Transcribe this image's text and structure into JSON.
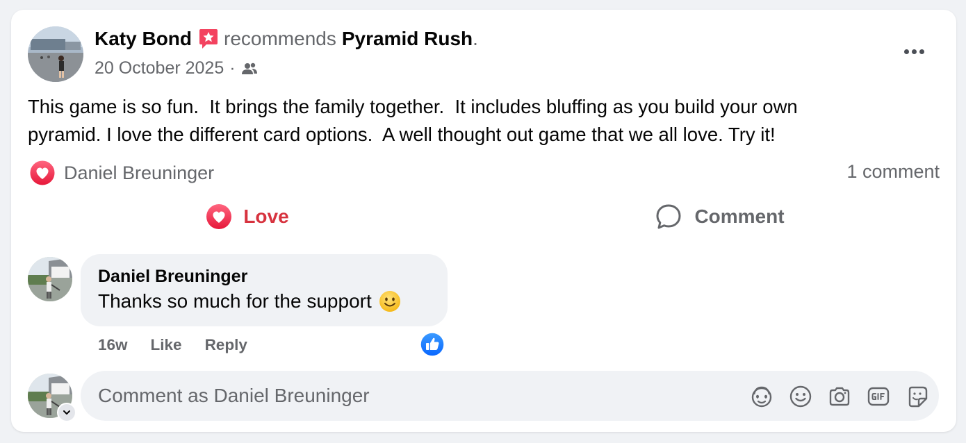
{
  "post": {
    "author": "Katy Bond",
    "action_text": "recommends",
    "page_name": "Pyramid Rush",
    "page_suffix": ".",
    "date": "20 October 2025",
    "separator": "·",
    "audience_icon": "friends-icon",
    "more_icon": "more-horizontal-icon",
    "body_line1": "This game is so fun.  It brings the family together.  It includes bluffing as you build your own",
    "body_line2": "pyramid. I love the different card options.  A well thought out game that we all love. Try it!",
    "reaction_icon": "love-reaction-icon",
    "reactor_name": "Daniel Breuninger",
    "comment_count": "1 comment",
    "love_label": "Love",
    "comment_label": "Comment"
  },
  "comment": {
    "author": "Daniel Breuninger",
    "text": "Thanks so much for the support",
    "emoji_icon": "smiley-emoji-icon",
    "time": "16w",
    "like_label": "Like",
    "reply_label": "Reply",
    "reaction_icon": "like-reaction-icon"
  },
  "composer": {
    "placeholder": "Comment as Daniel Breuninger",
    "icons": [
      "avatar-sticker-icon",
      "emoji-icon",
      "camera-icon",
      "gif-icon",
      "sticker-icon"
    ]
  },
  "colors": {
    "love_red": "#d7333f",
    "like_blue": "#1877f2",
    "text_gray": "#65676b",
    "bubble_bg": "#f0f2f5",
    "recommend_badge": "#f3425f"
  }
}
